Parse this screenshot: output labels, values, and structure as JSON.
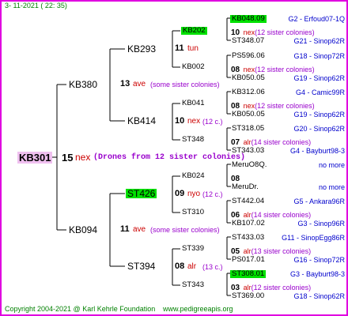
{
  "header": {
    "date": "3- 11-2021 ( 22: 35)"
  },
  "footer": {
    "copyright": "Copyright 2004-2021 @ Karl Kehrle Foundation",
    "url": "www.pedigreeapis.org"
  },
  "root": {
    "id": "KB301",
    "num": "15",
    "race": "nex",
    "note": "(Drones from 12 sister colonies)"
  },
  "gen1": [
    {
      "id": "KB380",
      "num": "13",
      "race": "ave",
      "note": "(some sister colonies)"
    },
    {
      "id": "KB094",
      "num": "11",
      "race": "ave",
      "note": "(some sister colonies)"
    }
  ],
  "gen2": [
    {
      "id": "KB293",
      "num": "11",
      "race": "tun",
      "note": ""
    },
    {
      "id": "KB414",
      "num": "10",
      "race": "nex",
      "note": "(12 c.)"
    },
    {
      "id": "ST426",
      "num": "09",
      "race": "nyo",
      "note": "(12 c.)"
    },
    {
      "id": "ST394",
      "num": "08",
      "race": "alr",
      "note": "(13 c.)"
    }
  ],
  "gen3": [
    {
      "id": "KB202",
      "num": "10",
      "race": "nex",
      "note": "(12 sister colonies)"
    },
    {
      "id": "KB002",
      "num": "08",
      "race": "nex",
      "note": "(12 sister colonies)"
    },
    {
      "id": "KB041",
      "num": "08",
      "race": "nex",
      "note": "(12 sister colonies)"
    },
    {
      "id": "ST348",
      "num": "07",
      "race": "alr",
      "note": "(14 sister colonies)"
    },
    {
      "id": "KB024",
      "num": "08",
      "race": "",
      "note": ""
    },
    {
      "id": "ST310",
      "num": "06",
      "race": "alr",
      "note": "(14 sister colonies)"
    },
    {
      "id": "ST339",
      "num": "05",
      "race": "alr",
      "note": "(13 sister colonies)"
    },
    {
      "id": "ST343",
      "num": "03",
      "race": "alr",
      "note": "(12 sister colonies)"
    }
  ],
  "gen4": [
    {
      "id": "KB048.09",
      "pn": "G2 - Erfoud07-1Q"
    },
    {
      "id": "ST348.07",
      "pn": "G21 - Sinop62R"
    },
    {
      "id": "PS596.06",
      "pn": "G18 - Sinop72R"
    },
    {
      "id": "KB050.05",
      "pn": "G19 - Sinop62R"
    },
    {
      "id": "KB312.06",
      "pn": "G4 - Camic99R"
    },
    {
      "id": "KB050.05",
      "pn": "G19 - Sinop62R"
    },
    {
      "id": "ST318.05",
      "pn": "G20 - Sinop62R"
    },
    {
      "id": "ST343.03",
      "pn": "G4 - Bayburt98-3"
    },
    {
      "id": "MeruO8Q.",
      "pn": "no more"
    },
    {
      "id": "MeruDr.",
      "pn": "no more"
    },
    {
      "id": "ST442.04",
      "pn": "G5 - Ankara96R"
    },
    {
      "id": "KB107.02",
      "pn": "G3 - Sinop96R"
    },
    {
      "id": "ST433.03",
      "pn": "G11 - SinopEgg86R"
    },
    {
      "id": "PS017.01",
      "pn": "G16 - Sinop72R"
    },
    {
      "id": "ST308.01",
      "pn": "G3 - Bayburt98-3"
    },
    {
      "id": "ST369.00",
      "pn": "G18 - Sinop62R"
    }
  ]
}
